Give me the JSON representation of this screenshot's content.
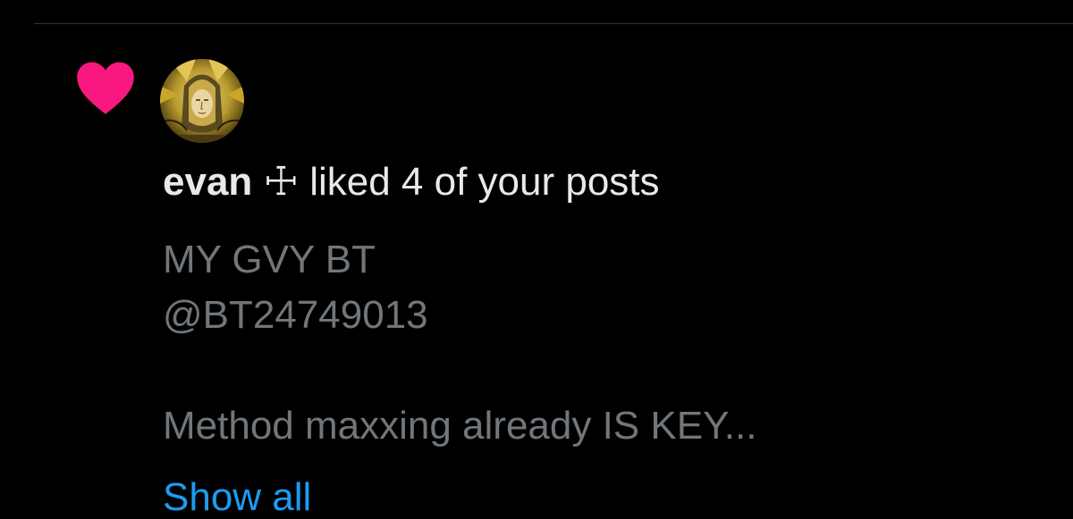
{
  "notification": {
    "type_icon": "heart-icon",
    "icon_color": "#f91880",
    "avatar": "user-avatar-gold-portrait",
    "actor_name": "evan",
    "actor_emblem": "☩",
    "action_text": " liked 4 of your posts"
  },
  "post": {
    "line1": "MY GVY BT",
    "line2": "@BT24749013",
    "line3": "Method maxxing already IS KEY..."
  },
  "show_all_label": "Show all",
  "colors": {
    "background": "#000000",
    "primary_text": "#e7e9ea",
    "secondary_text": "#71767b",
    "link": "#1d9bf0",
    "heart": "#f91880"
  }
}
